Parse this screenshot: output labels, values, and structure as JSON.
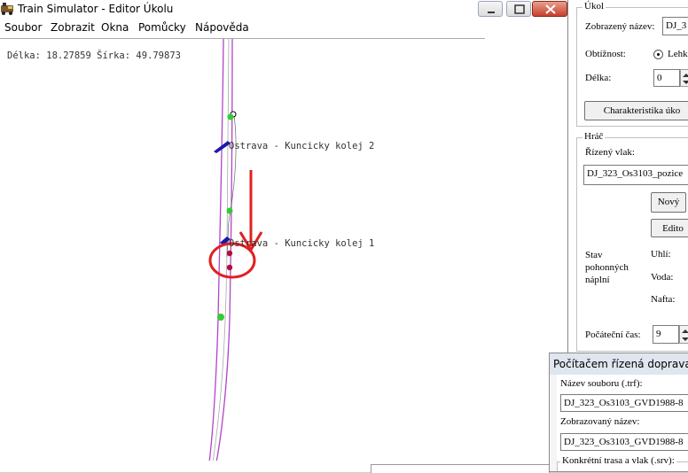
{
  "window": {
    "title": "Train Simulator - Editor Úkolu",
    "buttons": [
      "minimize",
      "maximize",
      "close"
    ]
  },
  "menu": {
    "items": [
      "Soubor",
      "Zobrazit",
      "Okna",
      "Pomůcky",
      "Nápověda"
    ]
  },
  "map": {
    "coordinates": "Délka: 18.27859 Šírka: 49.79873",
    "labels": [
      "Ostrava - Kuncicky kolej 2",
      "Ostrava - Kuncicky kolej 1"
    ],
    "colors": {
      "track": "#b044c8",
      "track_thin": "#555555",
      "marker_green": "#33cc33",
      "marker_red": "#b0103a",
      "marker_blue": "#1a1aa8",
      "annotation_red": "#e02020"
    }
  },
  "task_panel": {
    "group_title": "Úkol",
    "display_name_label": "Zobrazený název:",
    "display_name_value": "DJ_3",
    "difficulty_label": "Obtížnost:",
    "difficulty_selected": "Lehk",
    "length_label": "Délka:",
    "length_value": "0",
    "characteristics_button": "Charakteristika úko"
  },
  "player_panel": {
    "group_title": "Hráč",
    "train_label": "Řízený vlak:",
    "train_value": "DJ_323_Os3103_pozice",
    "new_button": "Nový",
    "edit_button": "Edito",
    "consumables_label": [
      "Stav",
      "pohonných",
      "náplní"
    ],
    "coal_label": "Uhlí:",
    "water_label": "Voda:",
    "diesel_label": "Nafta:",
    "start_time_label": "Počáteční čas:",
    "start_time_value": "9"
  },
  "ai_traffic_window": {
    "title": "Počítačem řízená doprava",
    "file_label": "Název souboru (.trf):",
    "file_value": "DJ_323_Os3103_GVD1988-8",
    "display_label": "Zobrazovaný název:",
    "display_value": "DJ_323_Os3103_GVD1988-8",
    "service_label": "Konkrétní trasa a vlak (.srv):"
  }
}
